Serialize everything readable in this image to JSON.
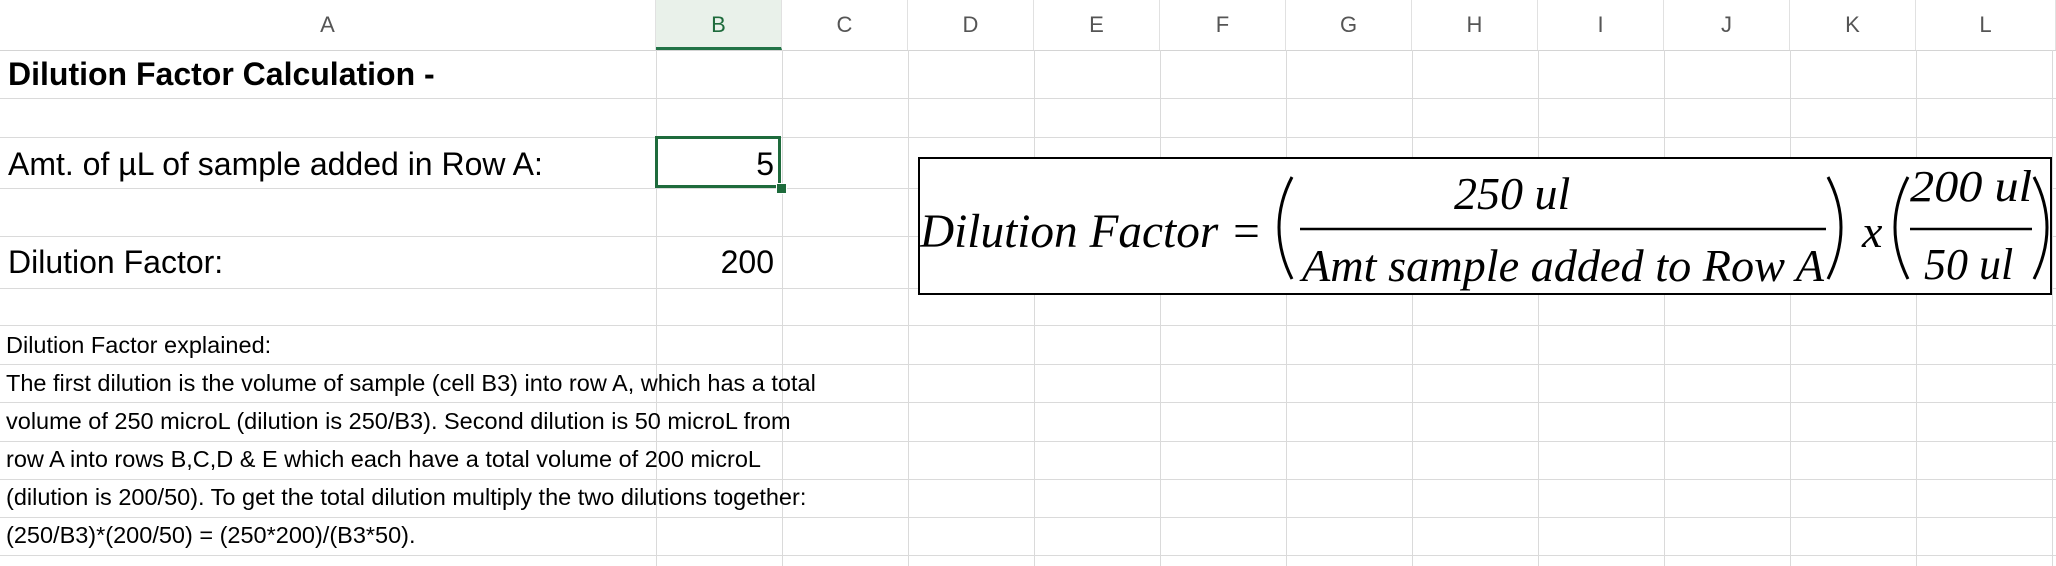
{
  "columns": [
    "A",
    "B",
    "C",
    "D",
    "E",
    "F",
    "G",
    "H",
    "I",
    "J",
    "K",
    "L"
  ],
  "selected_column": "B",
  "cells": {
    "title": "Dilution Factor Calculation -",
    "sample_label": "Amt. of µL of sample added in Row A:",
    "sample_value": "5",
    "dilution_label": "Dilution Factor:",
    "dilution_value": "200"
  },
  "explanation": [
    "Dilution Factor explained:",
    "The first dilution is the volume of sample (cell B3) into row A, which has a total",
    "volume of 250 microL (dilution is 250/B3). Second dilution is 50 microL from",
    "row A into rows B,C,D & E which each have a total volume of 200 microL",
    "(dilution is 200/50). To get the total dilution multiply the two dilutions together:",
    "(250/B3)*(200/50) = (250*200)/(B3*50)."
  ],
  "formula": {
    "lhs": "Dilution Factor =",
    "numerator1": "250 ul",
    "denominator1": "Amt sample added to Row A",
    "times": "x",
    "numerator2": "200 ul",
    "denominator2": "50 ul"
  }
}
